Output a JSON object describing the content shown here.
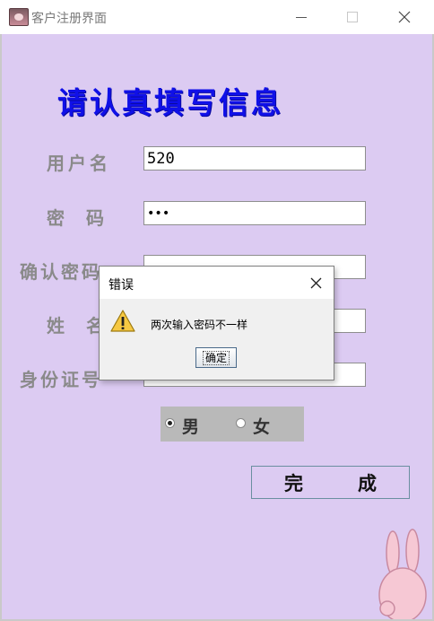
{
  "window": {
    "title": "客户注册界面",
    "controls": {
      "minimize": "minimize",
      "maximize": "maximize",
      "close": "close"
    }
  },
  "form": {
    "heading": "请认真填写信息",
    "fields": [
      {
        "label": "用户名",
        "value": "520"
      },
      {
        "label": "密　码",
        "value": "•••"
      },
      {
        "label": "确认密码",
        "value": ""
      },
      {
        "label": "姓　名",
        "value": ""
      },
      {
        "label": "身份证号",
        "value": ""
      }
    ],
    "gender": {
      "male": "男",
      "female": "女",
      "selected": "男"
    },
    "finish_label": "完　成"
  },
  "dialog": {
    "title": "错误",
    "message": "两次输入密码不一样",
    "ok_label": "确定",
    "icon": "warning-icon"
  },
  "colors": {
    "background": "#dccbf2",
    "heading": "#1010e8",
    "label": "#8a8a8a"
  }
}
